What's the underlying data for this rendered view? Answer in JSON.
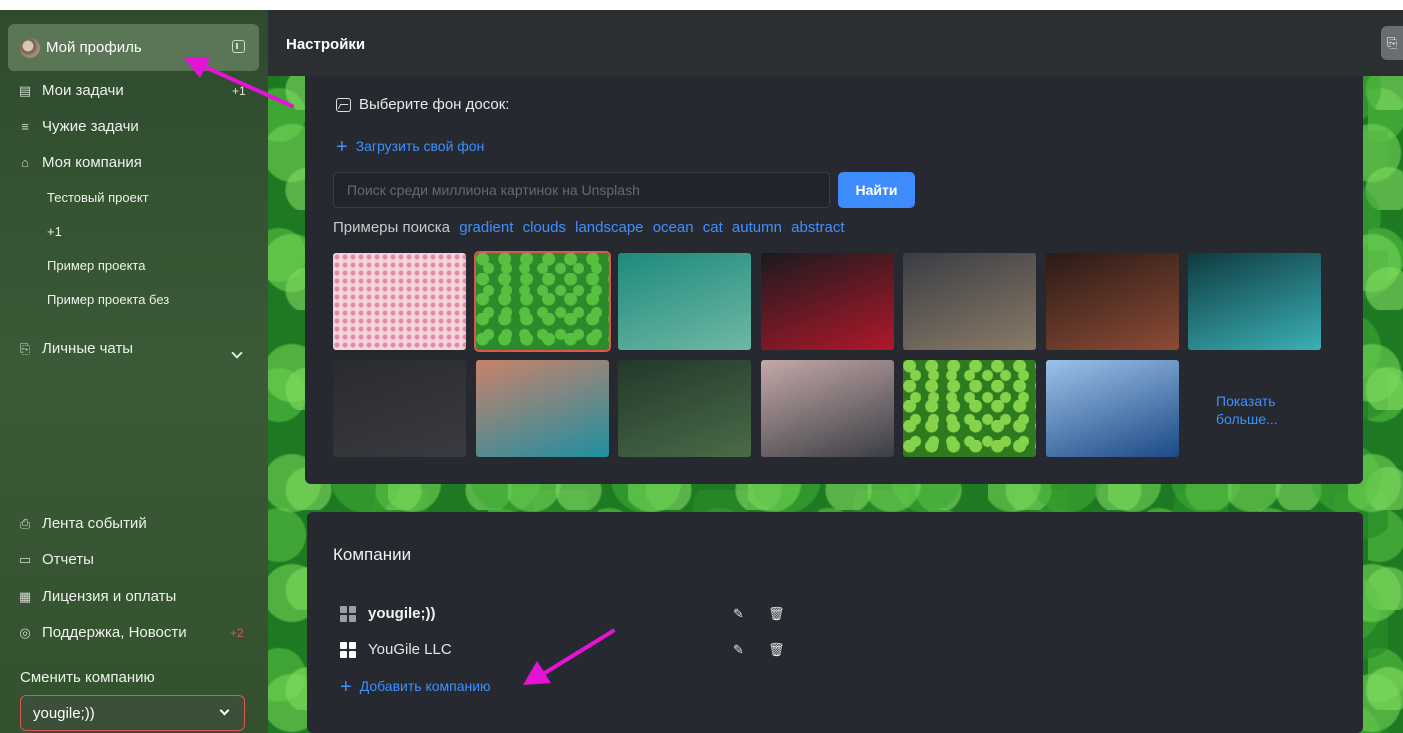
{
  "sidebar": {
    "profile_label": "Мой профиль",
    "items": [
      {
        "label": "Мои задачи",
        "badge": "+1"
      },
      {
        "label": "Чужие задачи"
      },
      {
        "label": "Моя компания"
      }
    ],
    "projects": [
      "Тестовый проект",
      "+1",
      "Пример проекта",
      "Пример проекта без"
    ],
    "chats_label": "Личные чаты",
    "bottom_items": [
      {
        "label": "Лента событий"
      },
      {
        "label": "Отчеты"
      },
      {
        "label": "Лицензия и оплаты"
      },
      {
        "label": "Поддержка, Новости",
        "badge": "+2"
      }
    ],
    "switch_company_label": "Сменить компанию",
    "selected_company": "yougile;))"
  },
  "header": {
    "title": "Настройки"
  },
  "background": {
    "title": "Выберите фон досок:",
    "upload_label": "Загрузить свой фон",
    "search_placeholder": "Поиск среди миллиона картинок на Unsplash",
    "find_button": "Найти",
    "examples_label": "Примеры поиска",
    "examples": [
      "gradient",
      "clouds",
      "landscape",
      "ocean",
      "cat",
      "autumn",
      "abstract"
    ],
    "show_more": [
      "Показать",
      "больше..."
    ],
    "thumbnails": [
      {
        "name": "pink-hearts-thumb",
        "colors": [
          "#f3d3dc",
          "#e58aa3"
        ],
        "selected": false
      },
      {
        "name": "clover-thumb",
        "colors": [
          "#2c8a2b",
          "#58c040"
        ],
        "selected": true
      },
      {
        "name": "aerial-sea-thumb",
        "colors": [
          "#1e8a7c",
          "#6fb8a5"
        ],
        "selected": false
      },
      {
        "name": "red-car-thumb",
        "colors": [
          "#1a1a1e",
          "#b0182a"
        ],
        "selected": false
      },
      {
        "name": "laptop-desk-thumb",
        "colors": [
          "#3a3d44",
          "#8a7a66"
        ],
        "selected": false
      },
      {
        "name": "violin-thumb",
        "colors": [
          "#2a1a16",
          "#8c4b36"
        ],
        "selected": false
      },
      {
        "name": "teal-water-thumb",
        "colors": [
          "#0e3b40",
          "#3bb0b5"
        ],
        "selected": false
      },
      {
        "name": "dark-wood-thumb",
        "colors": [
          "#2a2b2f",
          "#3a3b40"
        ],
        "selected": false
      },
      {
        "name": "mountain-lake-thumb",
        "colors": [
          "#c9826a",
          "#1f8fa0"
        ],
        "selected": false
      },
      {
        "name": "forest-aerial-thumb",
        "colors": [
          "#23382a",
          "#4a6b48"
        ],
        "selected": false
      },
      {
        "name": "road-thumb",
        "colors": [
          "#c4a8a8",
          "#3a3e44"
        ],
        "selected": false
      },
      {
        "name": "grass-thumb",
        "colors": [
          "#2e7a1f",
          "#86d24a"
        ],
        "selected": false
      },
      {
        "name": "blue-lake-thumb",
        "colors": [
          "#9cc2e8",
          "#1c4a86"
        ],
        "selected": false
      }
    ]
  },
  "companies": {
    "title": "Компании",
    "list": [
      {
        "name": "yougile;))",
        "icon": "grid-icon-gray"
      },
      {
        "name": "YouGile LLC",
        "icon": "grid-icon-white"
      }
    ],
    "add_label": "Добавить компанию"
  },
  "colors": {
    "accent": "#3f8fff",
    "danger": "#e0564f",
    "annotation_arrow": "#e514d4"
  }
}
